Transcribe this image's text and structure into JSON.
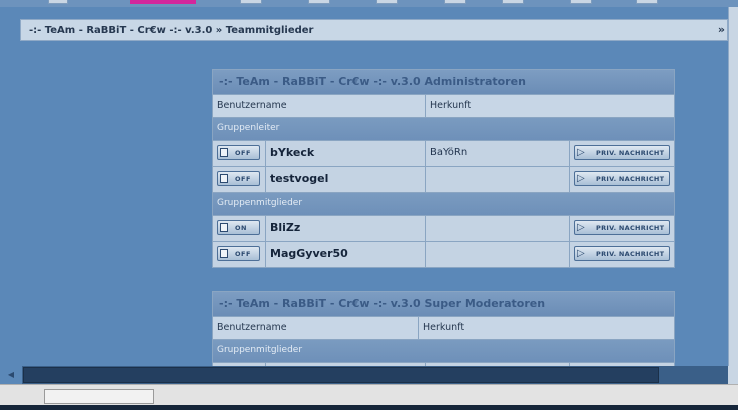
{
  "breadcrumb": {
    "text": "-:- TeAm - RaBBiT - Cr€w -:- v.3.0 » Teammitglieder",
    "arrow": "»"
  },
  "groups": [
    {
      "title": "-:- TeAm - RaBBiT - Cr€w -:- v.3.0 Administratoren",
      "col_username": "Benutzername",
      "col_origin": "Herkunft",
      "leaders_label": "Gruppenleiter",
      "members_label": "Gruppenmitglieder",
      "leaders": [
        {
          "status": "OFF",
          "name": "bYkeck",
          "origin": "BaYöRn",
          "pm": "PRIV. NACHRICHT"
        },
        {
          "status": "OFF",
          "name": "testvogel",
          "origin": "",
          "pm": "PRIV. NACHRICHT"
        }
      ],
      "members": [
        {
          "status": "ON",
          "name": "BliZz",
          "origin": "",
          "pm": "PRIV. NACHRICHT"
        },
        {
          "status": "OFF",
          "name": "MagGyver50",
          "origin": "",
          "pm": "PRIV. NACHRICHT"
        }
      ]
    },
    {
      "title": "-:- TeAm - RaBBiT - Cr€w -:- v.3.0 Super Moderatoren",
      "col_username": "Benutzername",
      "col_origin": "Herkunft",
      "members_label": "Gruppenmitglieder"
    }
  ],
  "icons": {
    "status": "profile-icon",
    "pm": "message-arrow-icon",
    "scroll_left": "left-arrow-icon"
  },
  "colors": {
    "page_background": "#5b88b8",
    "accent_tab": "#d3279c"
  }
}
